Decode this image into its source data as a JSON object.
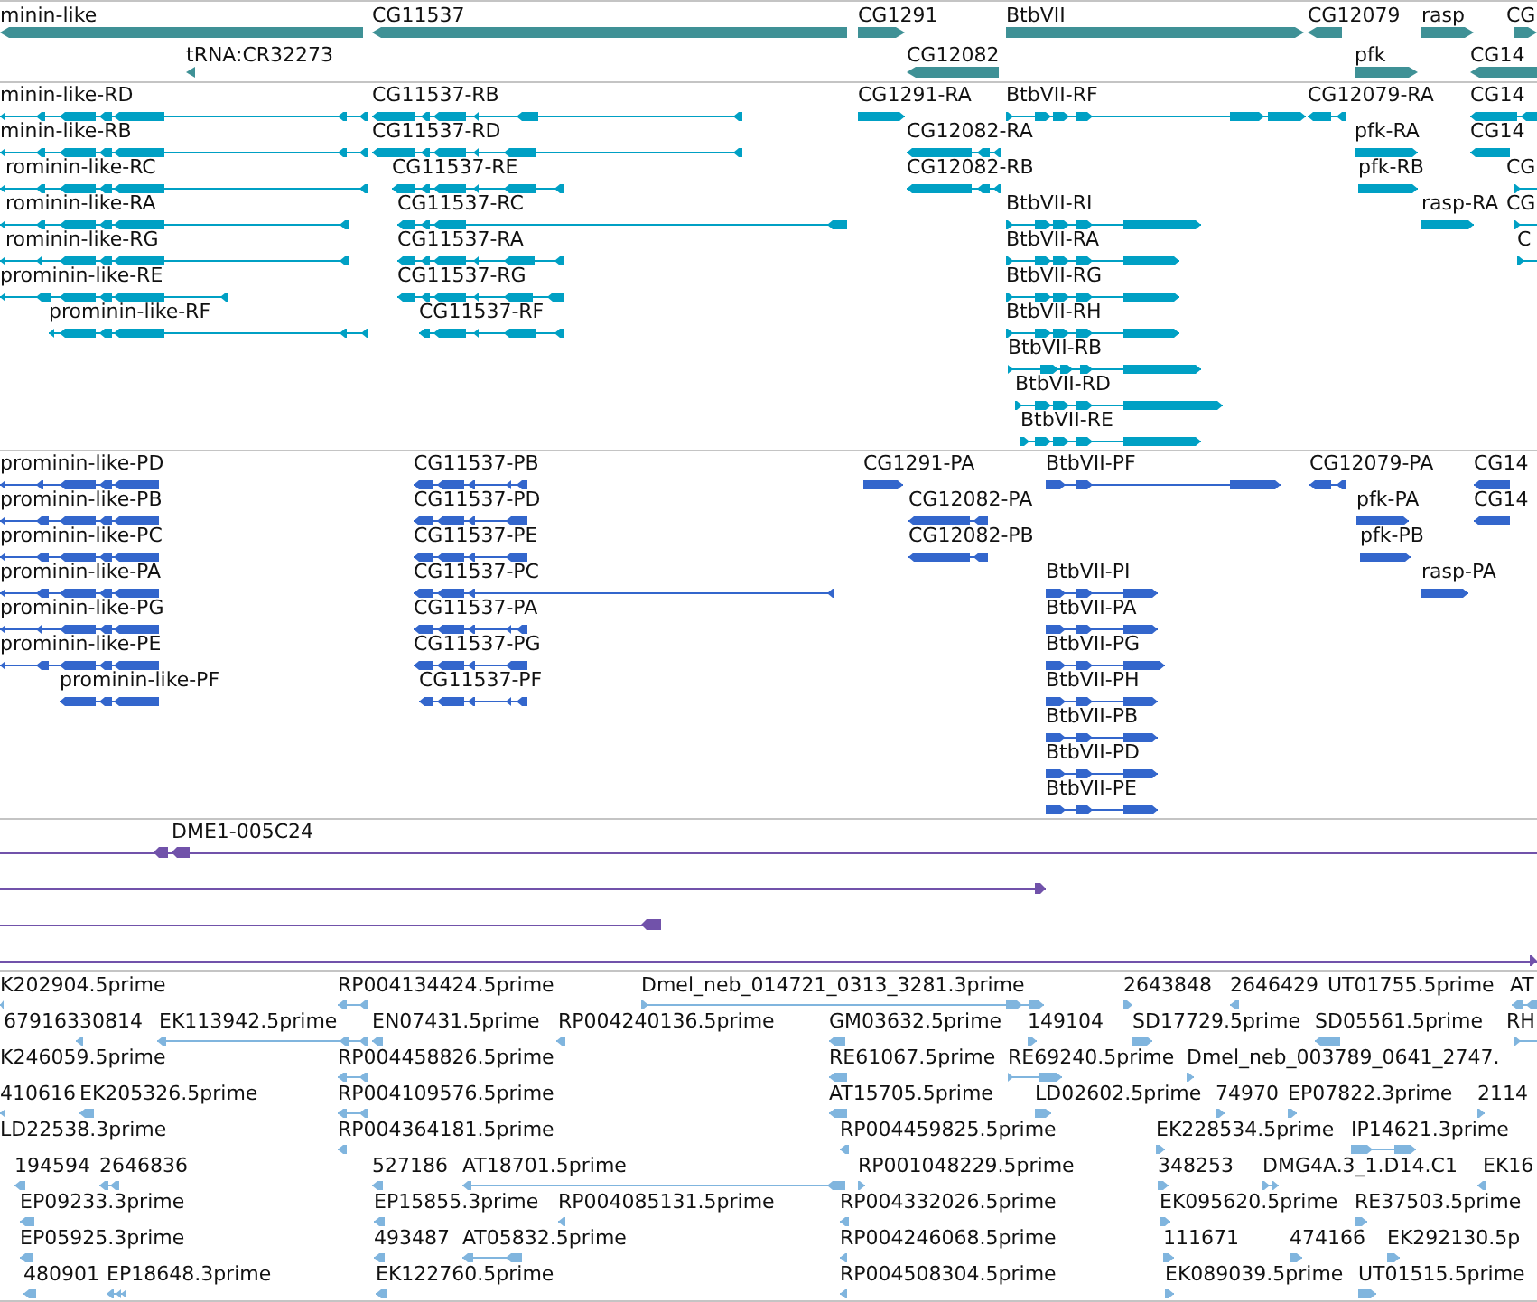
{
  "tracks": [
    {
      "kind": "gene",
      "rows": [
        {
          "features": [
            {
              "label": "minin-like",
              "reverse": true
            },
            {
              "label": "CG11537",
              "reverse": true
            },
            {
              "label": "CG1291",
              "reverse": false
            },
            {
              "label": "BtbVII",
              "reverse": false
            },
            {
              "label": "CG12079",
              "reverse": true
            },
            {
              "label": "rasp",
              "reverse": false
            },
            {
              "label": "CG",
              "reverse": false
            }
          ]
        },
        {
          "features": [
            {
              "label": "tRNA:CR32273",
              "reverse": true
            },
            {
              "label": "CG12082",
              "reverse": true
            },
            {
              "label": "pfk",
              "reverse": false
            },
            {
              "label": "CG14",
              "reverse": true
            }
          ]
        }
      ]
    },
    {
      "kind": "transcript",
      "rows": [
        {
          "features": [
            {
              "label": "minin-like-RD",
              "reverse": true
            },
            {
              "label": "CG11537-RB",
              "reverse": true
            },
            {
              "label": "CG1291-RA",
              "reverse": false
            },
            {
              "label": "BtbVII-RF",
              "reverse": false
            },
            {
              "label": "CG12079-RA",
              "reverse": true
            },
            {
              "label": "CG14",
              "reverse": true
            }
          ]
        },
        {
          "features": [
            {
              "label": "minin-like-RB",
              "reverse": true
            },
            {
              "label": "CG11537-RD",
              "reverse": true
            },
            {
              "label": "CG12082-RA",
              "reverse": true
            },
            {
              "label": "pfk-RA",
              "reverse": false
            },
            {
              "label": "CG14",
              "reverse": true
            }
          ]
        },
        {
          "features": [
            {
              "label": "rominin-like-RC",
              "reverse": true
            },
            {
              "label": "CG11537-RE",
              "reverse": true
            },
            {
              "label": "CG12082-RB",
              "reverse": true
            },
            {
              "label": "pfk-RB",
              "reverse": false
            },
            {
              "label": "CG",
              "reverse": false
            }
          ]
        },
        {
          "features": [
            {
              "label": "rominin-like-RA",
              "reverse": true
            },
            {
              "label": "CG11537-RC",
              "reverse": true
            },
            {
              "label": "BtbVII-RI",
              "reverse": false
            },
            {
              "label": "rasp-RA",
              "reverse": false
            },
            {
              "label": "CG",
              "reverse": false
            }
          ]
        },
        {
          "features": [
            {
              "label": "rominin-like-RG",
              "reverse": true
            },
            {
              "label": "CG11537-RA",
              "reverse": true
            },
            {
              "label": "BtbVII-RA",
              "reverse": false
            },
            {
              "label": "C",
              "reverse": false
            }
          ]
        },
        {
          "features": [
            {
              "label": "prominin-like-RE",
              "reverse": true
            },
            {
              "label": "CG11537-RG",
              "reverse": true
            },
            {
              "label": "BtbVII-RG",
              "reverse": false
            }
          ]
        },
        {
          "features": [
            {
              "label": "prominin-like-RF",
              "reverse": true
            },
            {
              "label": "CG11537-RF",
              "reverse": true
            },
            {
              "label": "BtbVII-RH",
              "reverse": false
            }
          ]
        },
        {
          "features": [
            {
              "label": "BtbVII-RB",
              "reverse": false
            }
          ]
        },
        {
          "features": [
            {
              "label": "BtbVII-RD",
              "reverse": false
            }
          ]
        },
        {
          "features": [
            {
              "label": "BtbVII-RE",
              "reverse": false
            }
          ]
        }
      ]
    },
    {
      "kind": "protein",
      "rows": [
        {
          "features": [
            {
              "label": "prominin-like-PD",
              "reverse": true
            },
            {
              "label": "CG11537-PB",
              "reverse": true
            },
            {
              "label": "CG1291-PA",
              "reverse": false
            },
            {
              "label": "BtbVII-PF",
              "reverse": false
            },
            {
              "label": "CG12079-PA",
              "reverse": true
            },
            {
              "label": "CG14",
              "reverse": true
            }
          ]
        },
        {
          "features": [
            {
              "label": "prominin-like-PB",
              "reverse": true
            },
            {
              "label": "CG11537-PD",
              "reverse": true
            },
            {
              "label": "CG12082-PA",
              "reverse": true
            },
            {
              "label": "pfk-PA",
              "reverse": false
            },
            {
              "label": "CG14",
              "reverse": true
            }
          ]
        },
        {
          "features": [
            {
              "label": "prominin-like-PC",
              "reverse": true
            },
            {
              "label": "CG11537-PE",
              "reverse": true
            },
            {
              "label": "CG12082-PB",
              "reverse": true
            },
            {
              "label": "pfk-PB",
              "reverse": false
            }
          ]
        },
        {
          "features": [
            {
              "label": "prominin-like-PA",
              "reverse": true
            },
            {
              "label": "CG11537-PC",
              "reverse": true
            },
            {
              "label": "BtbVII-PI",
              "reverse": false
            },
            {
              "label": "rasp-PA",
              "reverse": false
            }
          ]
        },
        {
          "features": [
            {
              "label": "prominin-like-PG",
              "reverse": true
            },
            {
              "label": "CG11537-PA",
              "reverse": true
            },
            {
              "label": "BtbVII-PA",
              "reverse": false
            }
          ]
        },
        {
          "features": [
            {
              "label": "prominin-like-PE",
              "reverse": true
            },
            {
              "label": "CG11537-PG",
              "reverse": true
            },
            {
              "label": "BtbVII-PG",
              "reverse": false
            }
          ]
        },
        {
          "features": [
            {
              "label": "prominin-like-PF",
              "reverse": true
            },
            {
              "label": "CG11537-PF",
              "reverse": true
            },
            {
              "label": "BtbVII-PH",
              "reverse": false
            }
          ]
        },
        {
          "features": [
            {
              "label": "BtbVII-PB",
              "reverse": false
            }
          ]
        },
        {
          "features": [
            {
              "label": "BtbVII-PD",
              "reverse": false
            }
          ]
        },
        {
          "features": [
            {
              "label": "BtbVII-PE",
              "reverse": false
            }
          ]
        }
      ]
    },
    {
      "kind": "clone",
      "rows": [
        {
          "features": [
            {
              "label": "DME1-005C24",
              "reverse": true
            }
          ]
        },
        {
          "features": [
            {
              "reverse": false
            }
          ]
        },
        {
          "features": [
            {
              "reverse": true
            }
          ]
        },
        {
          "features": [
            {
              "reverse": false
            }
          ]
        }
      ]
    },
    {
      "kind": "read",
      "rows": [
        {
          "features": [
            {
              "label": "K202904.5prime",
              "reverse": true
            },
            {
              "label": "RP004134424.5prime",
              "reverse": true
            },
            {
              "label": "Dmel_neb_014721_0313_3281.3prime",
              "reverse": false
            },
            {
              "label": "2643848",
              "reverse": false
            },
            {
              "label": "2646429",
              "reverse": true
            },
            {
              "label": "UT01755.5prime"
            },
            {
              "label": "AT",
              "reverse": true
            }
          ]
        },
        {
          "features": [
            {
              "label": "67916330814",
              "reverse": true
            },
            {
              "label": "EK113942.5prime",
              "reverse": true
            },
            {
              "label": "EN07431.5prime",
              "reverse": true
            },
            {
              "label": "RP004240136.5prime",
              "reverse": true
            },
            {
              "label": "GM03632.5prime",
              "reverse": true
            },
            {
              "label": "149104",
              "reverse": false
            },
            {
              "label": "SD17729.5prime",
              "reverse": false
            },
            {
              "label": "SD05561.5prime",
              "reverse": true
            },
            {
              "label": "RH",
              "reverse": false
            }
          ]
        },
        {
          "features": [
            {
              "label": "K246059.5prime"
            },
            {
              "label": "RP004458826.5prime",
              "reverse": true
            },
            {
              "label": "RE61067.5prime",
              "reverse": true
            },
            {
              "label": "RE69240.5prime",
              "reverse": false
            },
            {
              "label": "Dmel_neb_003789_0641_2747.",
              "reverse": false
            }
          ]
        },
        {
          "features": [
            {
              "label": "410616",
              "reverse": true
            },
            {
              "label": "EK205326.5prime",
              "reverse": true
            },
            {
              "label": "RP004109576.5prime",
              "reverse": true
            },
            {
              "label": "AT15705.5prime",
              "reverse": true
            },
            {
              "label": "LD02602.5prime",
              "reverse": false
            },
            {
              "label": "74970",
              "reverse": false
            },
            {
              "label": "EP07822.3prime",
              "reverse": false
            },
            {
              "label": "2114",
              "reverse": false
            }
          ]
        },
        {
          "features": [
            {
              "label": "LD22538.3prime"
            },
            {
              "label": "RP004364181.5prime",
              "reverse": true
            },
            {
              "label": "RP004459825.5prime",
              "reverse": true
            },
            {
              "label": "EK228534.5prime",
              "reverse": false
            },
            {
              "label": "IP14621.3prime",
              "reverse": false
            }
          ]
        },
        {
          "features": [
            {
              "label": "194594",
              "reverse": true
            },
            {
              "label": "2646836",
              "reverse": true
            },
            {
              "label": "527186",
              "reverse": true
            },
            {
              "label": "AT18701.5prime",
              "reverse": true
            },
            {
              "label": "RP001048229.5prime",
              "reverse": false
            },
            {
              "label": "348253",
              "reverse": false
            },
            {
              "label": "DMG4A.3_1.D14.C1",
              "reverse": false
            },
            {
              "label": "EK16",
              "reverse": true
            }
          ]
        },
        {
          "features": [
            {
              "label": "EP09233.3prime",
              "reverse": true
            },
            {
              "label": "EP15855.3prime",
              "reverse": true
            },
            {
              "label": "RP004085131.5prime",
              "reverse": true
            },
            {
              "label": "RP004332026.5prime",
              "reverse": true
            },
            {
              "label": "EK095620.5prime",
              "reverse": false
            },
            {
              "label": "RE37503.5prime",
              "reverse": false
            }
          ]
        },
        {
          "features": [
            {
              "label": "EP05925.3prime",
              "reverse": true
            },
            {
              "label": "493487",
              "reverse": true
            },
            {
              "label": "AT05832.5prime",
              "reverse": true
            },
            {
              "label": "RP004246068.5prime",
              "reverse": true
            },
            {
              "label": "111671",
              "reverse": false
            },
            {
              "label": "474166",
              "reverse": false
            },
            {
              "label": "EK292130.5p",
              "reverse": false
            }
          ]
        },
        {
          "features": [
            {
              "label": "480901",
              "reverse": true
            },
            {
              "label": "EP18648.3prime",
              "reverse": true
            },
            {
              "label": "EK122760.5prime",
              "reverse": true
            },
            {
              "label": "RP004508304.5prime",
              "reverse": true
            },
            {
              "label": "EK089039.5prime",
              "reverse": false
            },
            {
              "label": "UT01515.5prime",
              "reverse": false
            }
          ]
        }
      ]
    }
  ]
}
